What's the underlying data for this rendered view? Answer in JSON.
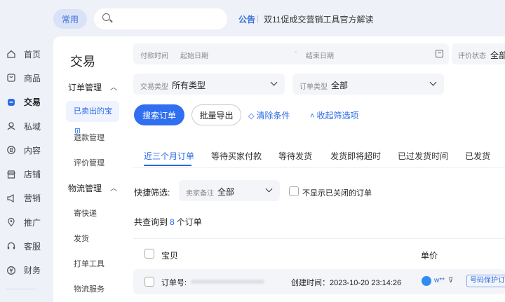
{
  "topbar": {
    "common_label": "常用",
    "search_placeholder": "",
    "notice_tag": "公告",
    "notice_sep": "|",
    "notice_text": "双11促成交营销工具官方解读"
  },
  "nav": {
    "items": [
      {
        "label": "首页",
        "icon": "home-icon"
      },
      {
        "label": "商品",
        "icon": "goods-icon"
      },
      {
        "label": "交易",
        "icon": "trade-icon"
      },
      {
        "label": "私域",
        "icon": "private-domain-icon"
      },
      {
        "label": "内容",
        "icon": "content-icon"
      },
      {
        "label": "店铺",
        "icon": "store-icon"
      },
      {
        "label": "营销",
        "icon": "marketing-icon"
      },
      {
        "label": "推广",
        "icon": "promotion-icon"
      },
      {
        "label": "客服",
        "icon": "service-icon"
      },
      {
        "label": "财务",
        "icon": "finance-icon"
      }
    ]
  },
  "subnav": {
    "title": "交易",
    "groups": [
      {
        "label": "订单管理",
        "items": [
          "已卖出的宝贝",
          "退款管理",
          "评价管理"
        ]
      },
      {
        "label": "物流管理",
        "items": [
          "寄快递",
          "发货",
          "打单工具",
          "物流服务"
        ]
      }
    ]
  },
  "filters": {
    "pay_time_label": "付款时间",
    "start_date": "起始日期",
    "dash": "-",
    "end_date": "结束日期",
    "rating_label": "评价状态",
    "rating_value": "全部",
    "trade_type_label": "交易类型",
    "trade_type_value": "所有类型",
    "order_type_label": "订单类型",
    "order_type_value": "全部"
  },
  "actions": {
    "search": "搜索订单",
    "export": "批量导出",
    "clear": "清除条件",
    "collapse": "收起筛选项"
  },
  "tabs": [
    "近三个月订单",
    "等待买家付款",
    "等待发货",
    "发货即将超时",
    "已过发货时间",
    "已发货"
  ],
  "quick": {
    "label": "快捷筛选:",
    "remark_label": "卖家备注",
    "remark_value": "全部",
    "hide_closed": "不显示已关闭的订单"
  },
  "result": {
    "prefix": "共查询到",
    "count": "8",
    "suffix": "个订单"
  },
  "table": {
    "col_item": "宝贝",
    "col_price": "单价"
  },
  "order": {
    "id_label": "订单号:",
    "created": "创建时间：2023-10-20 23:14:26",
    "buyer": "w**",
    "filter_glyph": "⊽",
    "badge": "号码保护订单"
  }
}
